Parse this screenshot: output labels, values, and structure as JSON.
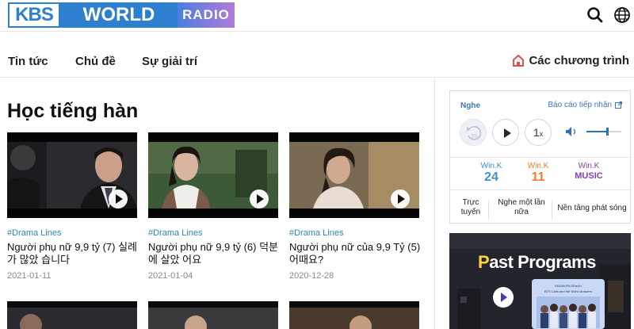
{
  "header": {
    "logo": {
      "kbs": "KBS",
      "world": "WORLD",
      "radio": "RADIO"
    },
    "icons": {
      "search": "search-icon",
      "language": "globe-icon"
    }
  },
  "nav": {
    "items": [
      {
        "label": "Tin tức"
      },
      {
        "label": "Chủ đề"
      },
      {
        "label": "Sự giải trí"
      }
    ],
    "programs_label": "Các chương trình"
  },
  "main": {
    "title": "Học tiếng hàn",
    "cards": [
      {
        "tag": "#Drama Lines",
        "title": "Người phụ nữ 9,9 tỷ (7) 실례가 많았 습니다",
        "date": "2021-01-11"
      },
      {
        "tag": "#Drama Lines",
        "title": "Người phụ nữ 9,9 tỷ (6) 덕분에 살았 어요",
        "date": "2021-01-04"
      },
      {
        "tag": "#Drama Lines",
        "title": "Người phụ nữ của 9,9 Tỷ (5) 어때요?",
        "date": "2020-12-28"
      }
    ]
  },
  "player": {
    "listen_label": "Nghe",
    "report_label": "Báo cáo tiếp nhận",
    "back_label": "15",
    "speed_label": "1",
    "speed_suffix": "x",
    "volume_level": 0.6,
    "channels": [
      {
        "line1": "Win.K",
        "line2": "24",
        "color": "#3f8fd6"
      },
      {
        "line1": "Win.K",
        "line2": "11",
        "color": "#f07c2a"
      },
      {
        "line1": "Win.K",
        "line2": "MUSIC",
        "color": "#8a3fb0"
      }
    ],
    "links": [
      {
        "line1": "Trực",
        "line2": "tuyến"
      },
      {
        "line1": "Nghe một lần",
        "line2": "nữa"
      },
      {
        "line1": "Nền tảng phát sóng",
        "line2": ""
      }
    ]
  },
  "banner": {
    "title_first": "P",
    "title_rest": "ast Programs",
    "card_line1": "KBSWORLDRadio",
    "card_line2": "BTS Calls and the World Answers"
  },
  "colors": {
    "brand_blue": "#2f7fd0",
    "link_blue": "#3b76b8",
    "tag_blue": "#2c87b4",
    "programs_icon": "#d9534f"
  }
}
